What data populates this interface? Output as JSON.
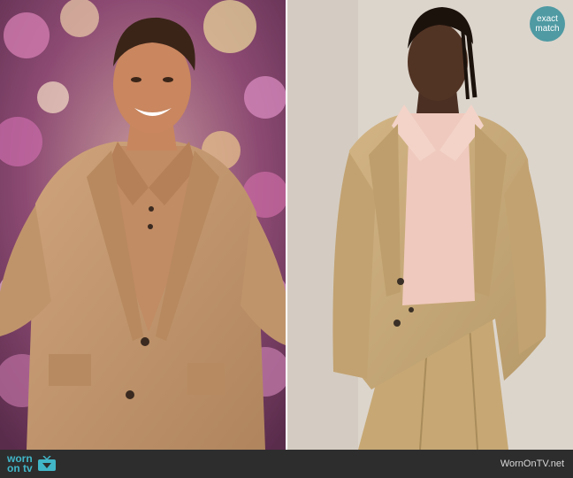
{
  "badge": {
    "line1": "exact",
    "line2": "match"
  },
  "footer": {
    "logo_word1": "worn",
    "logo_word2": "on tv",
    "logo_icon": "tv-icon",
    "site_name": "WornOnTV.net"
  },
  "colors": {
    "badge": "#4f9aa3",
    "footer_bg": "#2d2d2d",
    "logo_accent": "#41b6c8",
    "suit_camel": "#c49a72",
    "suit_khaki": "#c8a977"
  }
}
